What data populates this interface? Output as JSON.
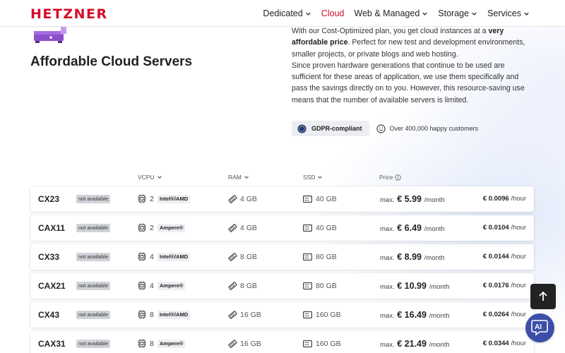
{
  "brand": {
    "logo_text": "HETZNER",
    "color": "#d50c2d"
  },
  "nav": {
    "items": [
      {
        "label": "Dedicated",
        "has_dropdown": true,
        "active": false
      },
      {
        "label": "Cloud",
        "has_dropdown": false,
        "active": true
      },
      {
        "label": "Web & Managed",
        "has_dropdown": true,
        "active": false
      },
      {
        "label": "Storage",
        "has_dropdown": true,
        "active": false
      },
      {
        "label": "Services",
        "has_dropdown": true,
        "active": false
      }
    ]
  },
  "hero": {
    "title": "Affordable Cloud Servers",
    "p1_pre": "With our Cost-Optimized plan, you get cloud instances at a ",
    "p1_bold": "very affordable price",
    "p1_post": ". Perfect for new test and development environments, smaller projects, or private blogs and web hosting.",
    "p2": "Since proven hardware generations that continue to be used are sufficient for these areas of application, we use them specifically and pass the savings directly on to you. However, this resource-saving use means that the number of available servers is limited.",
    "badge_gdpr": "GDPR-compliant",
    "badge_customers": "Over 400,000 happy customers"
  },
  "table": {
    "headers": {
      "vcpu": "VCPU",
      "ram": "RAM",
      "ssd": "SSD",
      "price": "Price"
    },
    "rows": [
      {
        "name": "CX23",
        "status": "not available",
        "vcpu": "2",
        "cpu_type": "Intel®/AMD",
        "ram": "4 GB",
        "ssd": "40 GB",
        "price_prefix": "max.",
        "price": "€ 5.99",
        "price_unit": "/month",
        "hourly": "€ 0.0096",
        "hourly_unit": "/hour"
      },
      {
        "name": "CAX11",
        "status": "not available",
        "vcpu": "2",
        "cpu_type": "Ampere®",
        "ram": "4 GB",
        "ssd": "40 GB",
        "price_prefix": "max.",
        "price": "€ 6.49",
        "price_unit": "/month",
        "hourly": "€ 0.0104",
        "hourly_unit": "/hour"
      },
      {
        "name": "CX33",
        "status": "not available",
        "vcpu": "4",
        "cpu_type": "Intel®/AMD",
        "ram": "8 GB",
        "ssd": "80 GB",
        "price_prefix": "max.",
        "price": "€ 8.99",
        "price_unit": "/month",
        "hourly": "€ 0.0144",
        "hourly_unit": "/hour"
      },
      {
        "name": "CAX21",
        "status": "not available",
        "vcpu": "4",
        "cpu_type": "Ampere®",
        "ram": "8 GB",
        "ssd": "80 GB",
        "price_prefix": "max.",
        "price": "€ 10.99",
        "price_unit": "/month",
        "hourly": "€ 0.0176",
        "hourly_unit": "/hour"
      },
      {
        "name": "CX43",
        "status": "not available",
        "vcpu": "8",
        "cpu_type": "Intel®/AMD",
        "ram": "16 GB",
        "ssd": "160 GB",
        "price_prefix": "max.",
        "price": "€ 16.49",
        "price_unit": "/month",
        "hourly": "€ 0.0264",
        "hourly_unit": "/hour"
      },
      {
        "name": "CAX31",
        "status": "not available",
        "vcpu": "8",
        "cpu_type": "Ampere®",
        "ram": "16 GB",
        "ssd": "160 GB",
        "price_prefix": "max.",
        "price": "€ 21.49",
        "price_unit": "/month",
        "hourly": "€ 0.0344",
        "hourly_unit": "/hour"
      }
    ]
  },
  "floating": {
    "ai_label": "AI"
  },
  "icons": {
    "nav_dropdown": "chevron-down-icon",
    "gdpr": "eu-flag-icon",
    "customers": "smiley-icon",
    "cpu": "cpu-chip-icon",
    "ram": "memory-icon",
    "ssd": "drive-icon",
    "price_info": "info-icon",
    "scroll_top": "arrow-up-icon",
    "ai_chat": "chat-bubble-icon"
  }
}
